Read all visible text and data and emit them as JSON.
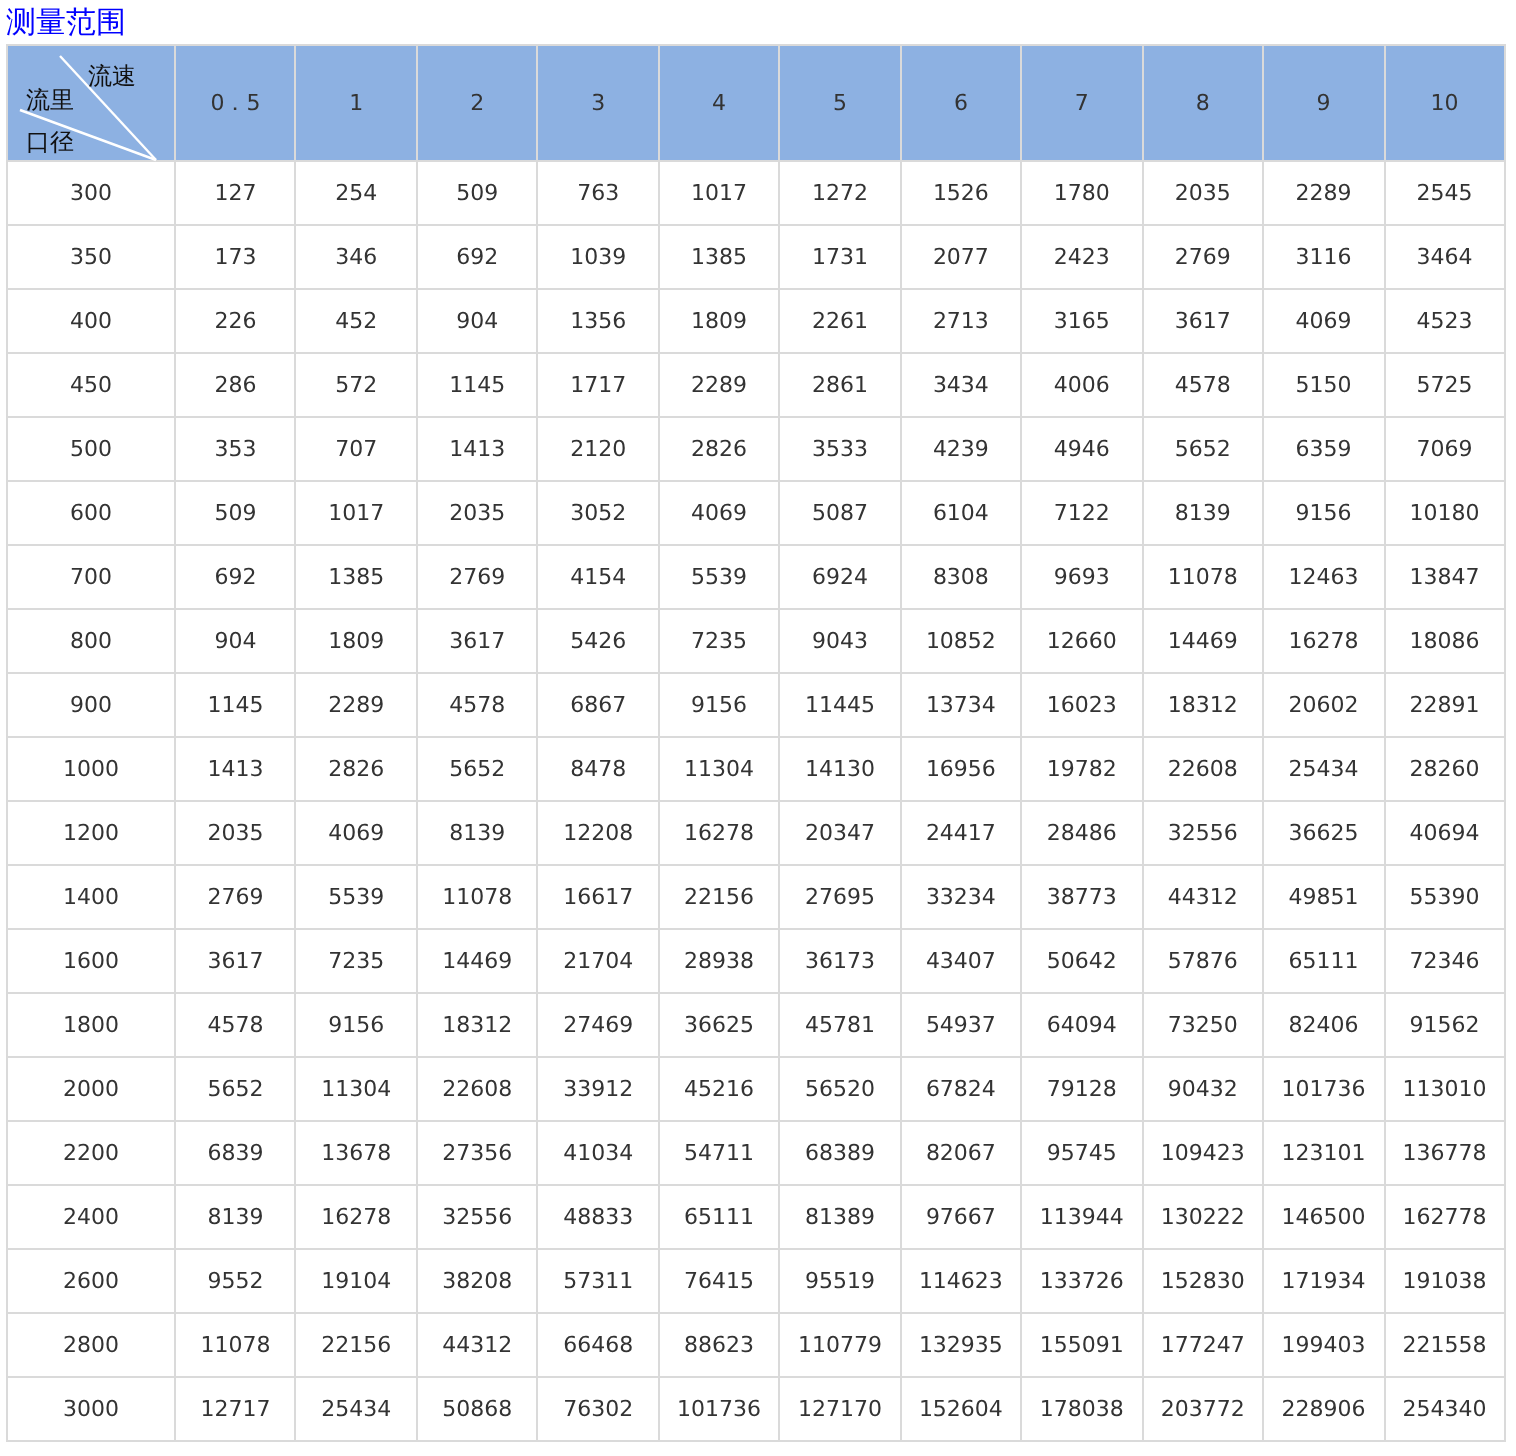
{
  "title": "测量范围",
  "table": {
    "corner": {
      "top_label": "流速",
      "middle_label": "流里",
      "bottom_label": "口径"
    },
    "columns": [
      "0．5",
      "1",
      "2",
      "3",
      "4",
      "5",
      "6",
      "7",
      "8",
      "9",
      "10"
    ],
    "rows": [
      {
        "diameter": "300",
        "values": [
          "127",
          "254",
          "509",
          "763",
          "1017",
          "1272",
          "1526",
          "1780",
          "2035",
          "2289",
          "2545"
        ]
      },
      {
        "diameter": "350",
        "values": [
          "173",
          "346",
          "692",
          "1039",
          "1385",
          "1731",
          "2077",
          "2423",
          "2769",
          "3116",
          "3464"
        ]
      },
      {
        "diameter": "400",
        "values": [
          "226",
          "452",
          "904",
          "1356",
          "1809",
          "2261",
          "2713",
          "3165",
          "3617",
          "4069",
          "4523"
        ]
      },
      {
        "diameter": "450",
        "values": [
          "286",
          "572",
          "1145",
          "1717",
          "2289",
          "2861",
          "3434",
          "4006",
          "4578",
          "5150",
          "5725"
        ]
      },
      {
        "diameter": "500",
        "values": [
          "353",
          "707",
          "1413",
          "2120",
          "2826",
          "3533",
          "4239",
          "4946",
          "5652",
          "6359",
          "7069"
        ]
      },
      {
        "diameter": "600",
        "values": [
          "509",
          "1017",
          "2035",
          "3052",
          "4069",
          "5087",
          "6104",
          "7122",
          "8139",
          "9156",
          "10180"
        ]
      },
      {
        "diameter": "700",
        "values": [
          "692",
          "1385",
          "2769",
          "4154",
          "5539",
          "6924",
          "8308",
          "9693",
          "11078",
          "12463",
          "13847"
        ]
      },
      {
        "diameter": "800",
        "values": [
          "904",
          "1809",
          "3617",
          "5426",
          "7235",
          "9043",
          "10852",
          "12660",
          "14469",
          "16278",
          "18086"
        ]
      },
      {
        "diameter": "900",
        "values": [
          "1145",
          "2289",
          "4578",
          "6867",
          "9156",
          "11445",
          "13734",
          "16023",
          "18312",
          "20602",
          "22891"
        ]
      },
      {
        "diameter": "1000",
        "values": [
          "1413",
          "2826",
          "5652",
          "8478",
          "11304",
          "14130",
          "16956",
          "19782",
          "22608",
          "25434",
          "28260"
        ]
      },
      {
        "diameter": "1200",
        "values": [
          "2035",
          "4069",
          "8139",
          "12208",
          "16278",
          "20347",
          "24417",
          "28486",
          "32556",
          "36625",
          "40694"
        ]
      },
      {
        "diameter": "1400",
        "values": [
          "2769",
          "5539",
          "11078",
          "16617",
          "22156",
          "27695",
          "33234",
          "38773",
          "44312",
          "49851",
          "55390"
        ]
      },
      {
        "diameter": "1600",
        "values": [
          "3617",
          "7235",
          "14469",
          "21704",
          "28938",
          "36173",
          "43407",
          "50642",
          "57876",
          "65111",
          "72346"
        ]
      },
      {
        "diameter": "1800",
        "values": [
          "4578",
          "9156",
          "18312",
          "27469",
          "36625",
          "45781",
          "54937",
          "64094",
          "73250",
          "82406",
          "91562"
        ]
      },
      {
        "diameter": "2000",
        "values": [
          "5652",
          "11304",
          "22608",
          "33912",
          "45216",
          "56520",
          "67824",
          "79128",
          "90432",
          "101736",
          "113010"
        ]
      },
      {
        "diameter": "2200",
        "values": [
          "6839",
          "13678",
          "27356",
          "41034",
          "54711",
          "68389",
          "82067",
          "95745",
          "109423",
          "123101",
          "136778"
        ]
      },
      {
        "diameter": "2400",
        "values": [
          "8139",
          "16278",
          "32556",
          "48833",
          "65111",
          "81389",
          "97667",
          "113944",
          "130222",
          "146500",
          "162778"
        ]
      },
      {
        "diameter": "2600",
        "values": [
          "9552",
          "19104",
          "38208",
          "57311",
          "76415",
          "95519",
          "114623",
          "133726",
          "152830",
          "171934",
          "191038"
        ]
      },
      {
        "diameter": "2800",
        "values": [
          "11078",
          "22156",
          "44312",
          "66468",
          "88623",
          "110779",
          "132935",
          "155091",
          "177247",
          "199403",
          "221558"
        ]
      },
      {
        "diameter": "3000",
        "values": [
          "12717",
          "25434",
          "50868",
          "76302",
          "101736",
          "127170",
          "152604",
          "178038",
          "203772",
          "228906",
          "254340"
        ]
      }
    ]
  }
}
